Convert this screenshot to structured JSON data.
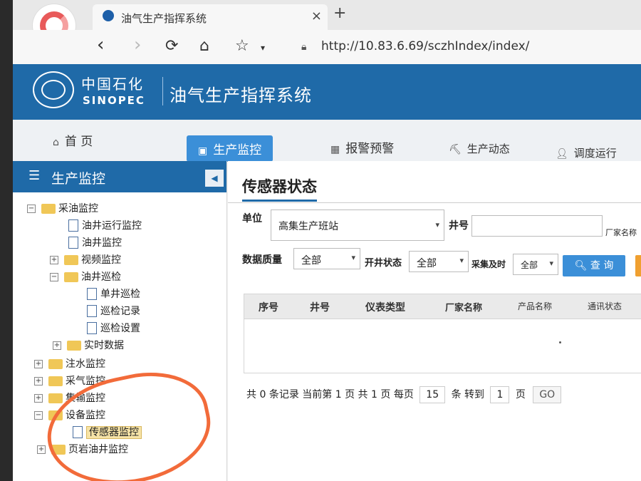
{
  "browser": {
    "tab_title": "油气生产指挥系统",
    "tab_close": "×",
    "new_tab": "+",
    "url": "http://10.83.6.69/sczhIndex/index/"
  },
  "header": {
    "brand_cn": "中国石化",
    "brand_en": "SINOPEC",
    "system_title": "油气生产指挥系统"
  },
  "mainnav": [
    {
      "label": "首 页",
      "icon": "home-icon"
    },
    {
      "label": "生产监控",
      "icon": "monitor-icon",
      "active": true
    },
    {
      "label": "报警预警",
      "icon": "alarm-icon"
    },
    {
      "label": "生产动态",
      "icon": "drill-icon"
    },
    {
      "label": "调度运行",
      "icon": "user-icon"
    }
  ],
  "sidebar": {
    "title": "生产监控",
    "tree": [
      {
        "label": "采油监控",
        "type": "folder",
        "toggle": "⊟"
      },
      {
        "label": "油井运行监控",
        "type": "page"
      },
      {
        "label": "油井监控",
        "type": "page"
      },
      {
        "label": "视频监控",
        "type": "folder",
        "toggle": "+"
      },
      {
        "label": "油井巡检",
        "type": "folder",
        "toggle": "−"
      },
      {
        "label": "单井巡检",
        "type": "page"
      },
      {
        "label": "巡检记录",
        "type": "page"
      },
      {
        "label": "巡检设置",
        "type": "page"
      },
      {
        "label": "实时数据",
        "type": "folder",
        "toggle": "+"
      },
      {
        "label": "注水监控",
        "type": "folder",
        "toggle": "+"
      },
      {
        "label": "采气监控",
        "type": "folder",
        "toggle": "+"
      },
      {
        "label": "集输监控",
        "type": "folder",
        "toggle": "+"
      },
      {
        "label": "设备监控",
        "type": "folder",
        "toggle": "−"
      },
      {
        "label": "传感器监控",
        "type": "page",
        "selected": true
      },
      {
        "label": "页岩油井监控",
        "type": "folder",
        "toggle": "+"
      }
    ]
  },
  "content": {
    "title": "传感器状态",
    "filters": {
      "unit_label": "单位",
      "unit_value": "高集生产班站",
      "well_label": "井号",
      "well_value": "",
      "vendor_label": "厂家名称",
      "quality_label": "数据质量",
      "quality_value": "全部",
      "open_label": "开井状态",
      "open_value": "全部",
      "timely_label": "采集及时",
      "timely_value": "全部",
      "query_button": "查 询"
    },
    "table": {
      "columns": [
        "序号",
        "井号",
        "仪表类型",
        "厂家名称",
        "产品名称",
        "通讯状态"
      ],
      "rows": []
    },
    "pager": {
      "total_prefix": "共",
      "total_records": "0",
      "records_suffix": "条记录 当前第",
      "current_page": "1",
      "pages_mid": "页 共",
      "total_pages": "1",
      "per_page_label": "页 每页",
      "per_page": "15",
      "goto_label": "条 转到",
      "goto_page": "1",
      "page_suffix": "页",
      "go_button": "GO"
    }
  }
}
